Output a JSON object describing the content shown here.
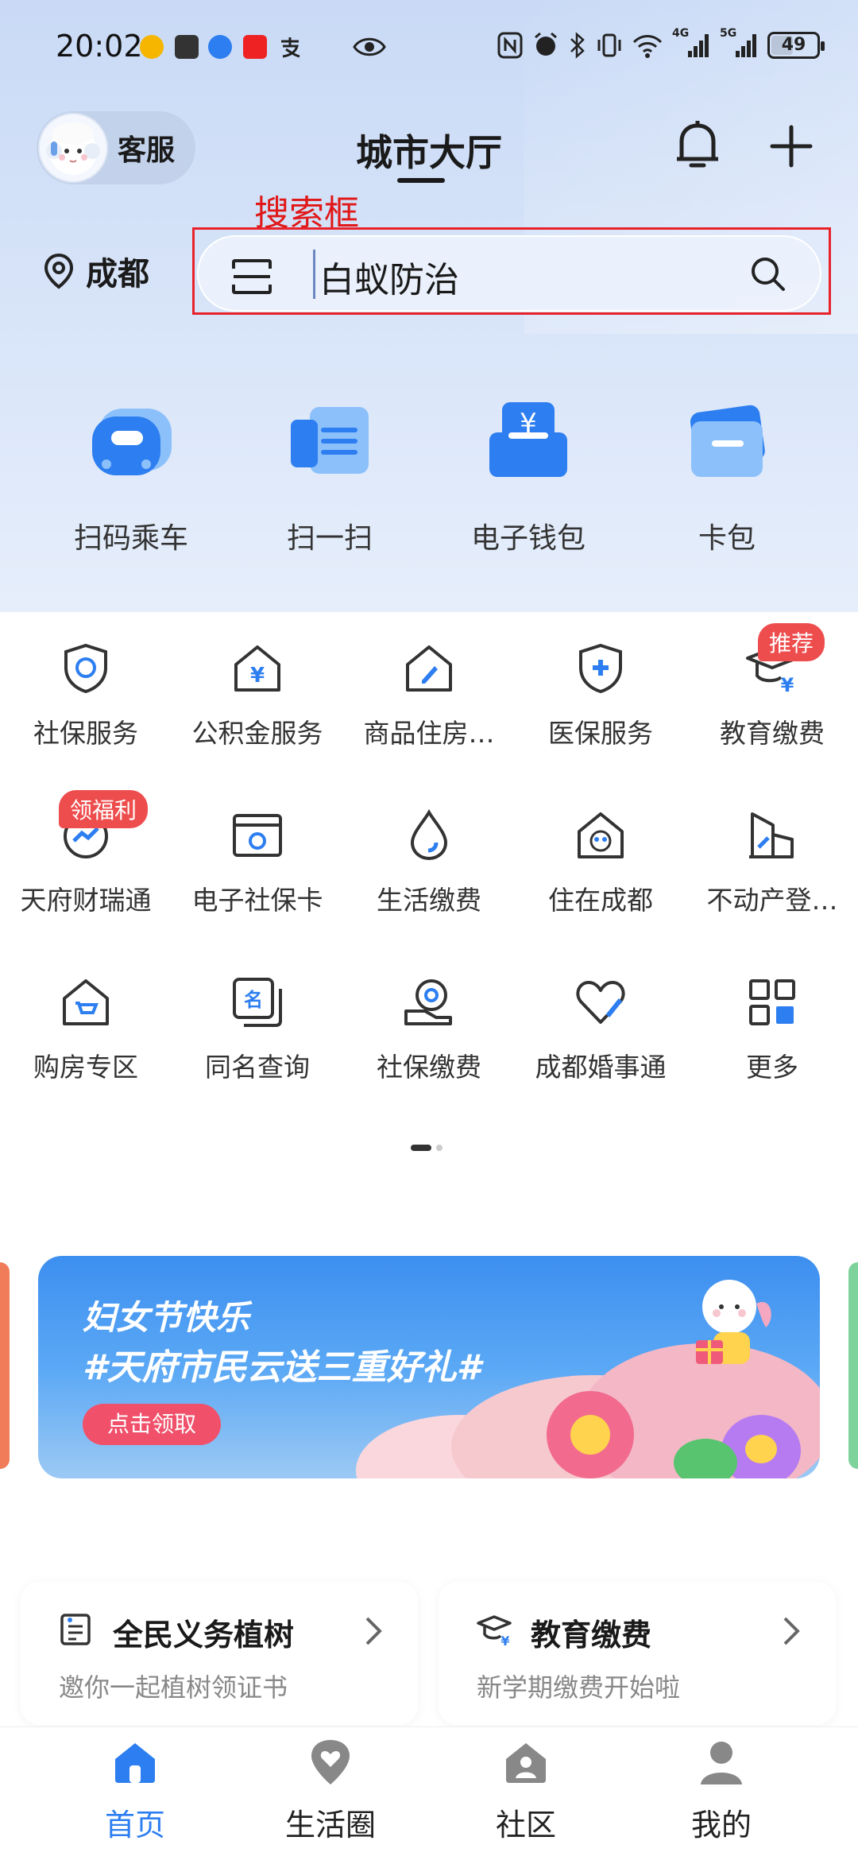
{
  "status_bar": {
    "time": "20:02",
    "network_label_1": "4G",
    "network_label_2": "5G",
    "battery": "49"
  },
  "header": {
    "customer_service_label": "客服",
    "title": "城市大厅"
  },
  "annotation": {
    "label": "搜索框",
    "color": "#e01818"
  },
  "location": {
    "city": "成都"
  },
  "search": {
    "value": "白蚁防治"
  },
  "quick_actions": [
    {
      "label": "扫码乘车",
      "icon": "bus-qr-icon"
    },
    {
      "label": "扫一扫",
      "icon": "scan-icon"
    },
    {
      "label": "电子钱包",
      "icon": "wallet-icon"
    },
    {
      "label": "卡包",
      "icon": "card-icon"
    }
  ],
  "services": [
    {
      "label": "社保服务",
      "icon": "social-security-shield-icon"
    },
    {
      "label": "公积金服务",
      "icon": "housing-fund-icon"
    },
    {
      "label": "商品住房…",
      "icon": "commercial-housing-icon"
    },
    {
      "label": "医保服务",
      "icon": "medical-insurance-icon"
    },
    {
      "label": "教育缴费",
      "icon": "education-payment-icon",
      "badge": "推荐"
    },
    {
      "label": "天府财瑞通",
      "icon": "finance-icon",
      "badge": "领福利"
    },
    {
      "label": "电子社保卡",
      "icon": "e-social-card-icon"
    },
    {
      "label": "生活缴费",
      "icon": "water-drop-icon"
    },
    {
      "label": "住在成都",
      "icon": "panda-house-icon"
    },
    {
      "label": "不动产登…",
      "icon": "real-estate-icon"
    },
    {
      "label": "购房专区",
      "icon": "house-cart-icon"
    },
    {
      "label": "同名查询",
      "icon": "name-query-icon"
    },
    {
      "label": "社保缴费",
      "icon": "social-payment-icon"
    },
    {
      "label": "成都婚事通",
      "icon": "heart-icon"
    },
    {
      "label": "更多",
      "icon": "grid-more-icon"
    }
  ],
  "banner": {
    "line1": "妇女节快乐",
    "line2": "#天府市民云送三重好礼#",
    "button": "点击领取"
  },
  "cards": [
    {
      "title": "全民义务植树",
      "subtitle": "邀你一起植树领证书",
      "icon": "certificate-icon"
    },
    {
      "title": "教育缴费",
      "subtitle": "新学期缴费开始啦",
      "icon": "graduation-cap-icon"
    }
  ],
  "bottom_nav": [
    {
      "label": "首页",
      "icon": "home-icon",
      "active": true
    },
    {
      "label": "生活圈",
      "icon": "heart-location-icon"
    },
    {
      "label": "社区",
      "icon": "community-icon"
    },
    {
      "label": "我的",
      "icon": "person-icon"
    }
  ],
  "colors": {
    "accent": "#2d7ef0",
    "badge": "#ee4d4d",
    "annotation_box": "#e8222b"
  }
}
